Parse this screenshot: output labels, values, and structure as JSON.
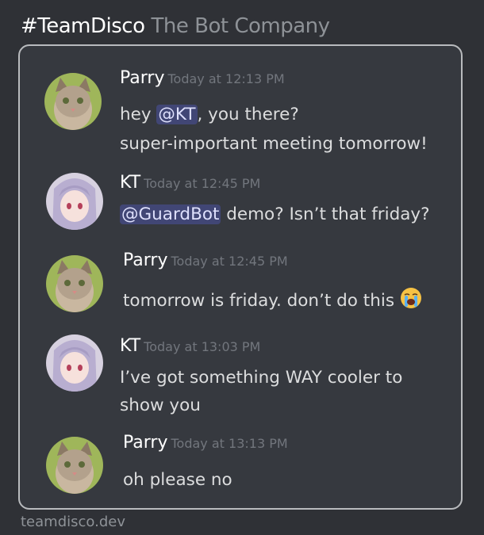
{
  "header": {
    "brand": "#TeamDisco",
    "tagline": "The Bot Company"
  },
  "messages": [
    {
      "author": "Parry",
      "timestamp": "Today at 12:13 PM",
      "lines": [
        {
          "mention": "@KT",
          "text": ", you there?",
          "prefix": "hey "
        },
        {
          "text": "super-important meeting tomorrow!"
        }
      ]
    },
    {
      "author": "KT",
      "timestamp": "Today at 12:45 PM",
      "lines": [
        {
          "mention": "@GuardBot",
          "text": " demo?  Isn’t that friday?"
        }
      ]
    },
    {
      "author": "Parry",
      "timestamp": "Today at 12:45 PM",
      "lines": [
        {
          "text": "tomorrow is friday. don’t do this",
          "emoji": "loudly-crying-face-emoji"
        }
      ]
    },
    {
      "author": "KT",
      "timestamp": "Today at 13:03 PM",
      "lines": [
        {
          "text": "I’ve got something WAY cooler to"
        },
        {
          "text": "show you"
        }
      ]
    },
    {
      "author": "Parry",
      "timestamp": "Today at 13:13 PM",
      "lines": [
        {
          "text": "oh please no"
        }
      ]
    }
  ],
  "footer": {
    "url": "teamdisco.dev"
  },
  "colors": {
    "background": "#2f3136",
    "card": "#36393f",
    "mention_bg": "#414675",
    "mention_text": "#dee0fc"
  }
}
